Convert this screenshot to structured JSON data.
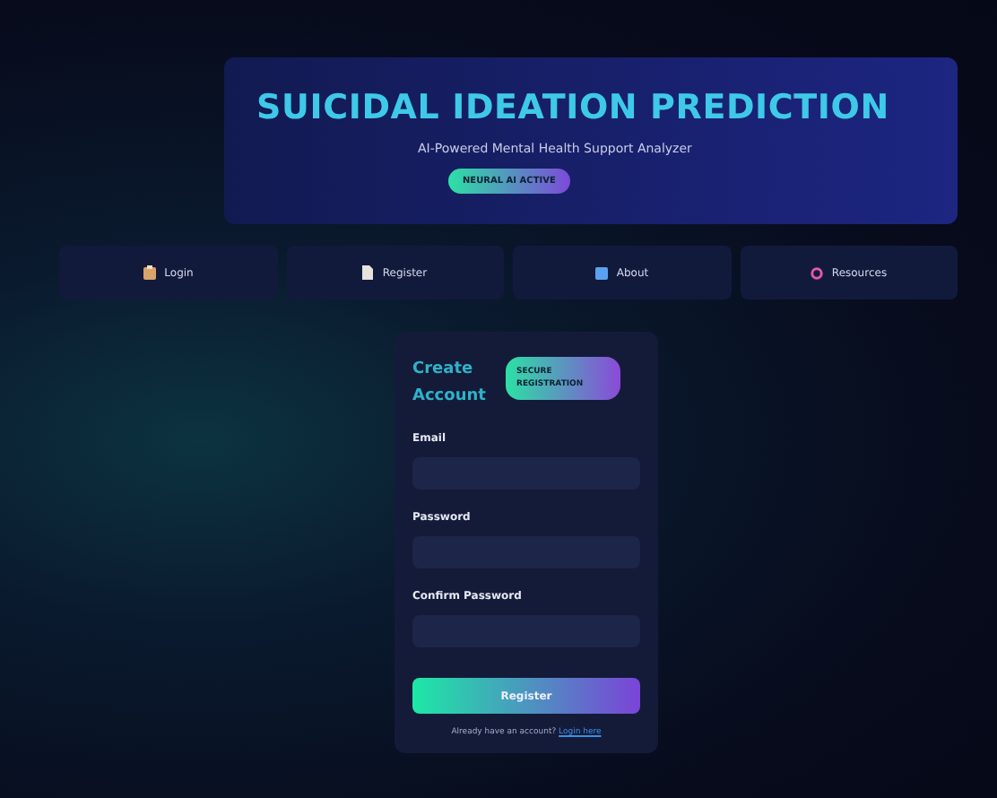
{
  "header": {
    "title": "SUICIDAL IDEATION PREDICTION",
    "subtitle": "AI-Powered Mental Health Support Analyzer",
    "badge": "NEURAL AI ACTIVE"
  },
  "nav": [
    {
      "label": "Login"
    },
    {
      "label": "Register"
    },
    {
      "label": "About"
    },
    {
      "label": "Resources"
    }
  ],
  "form": {
    "title": "Create Account",
    "badge": "SECURE REGISTRATION",
    "fields": [
      {
        "label": "Email"
      },
      {
        "label": "Password"
      },
      {
        "label": "Confirm Password"
      }
    ],
    "submit": "Register",
    "footer": {
      "text": "Already have an account?",
      "link": "Login here"
    }
  }
}
